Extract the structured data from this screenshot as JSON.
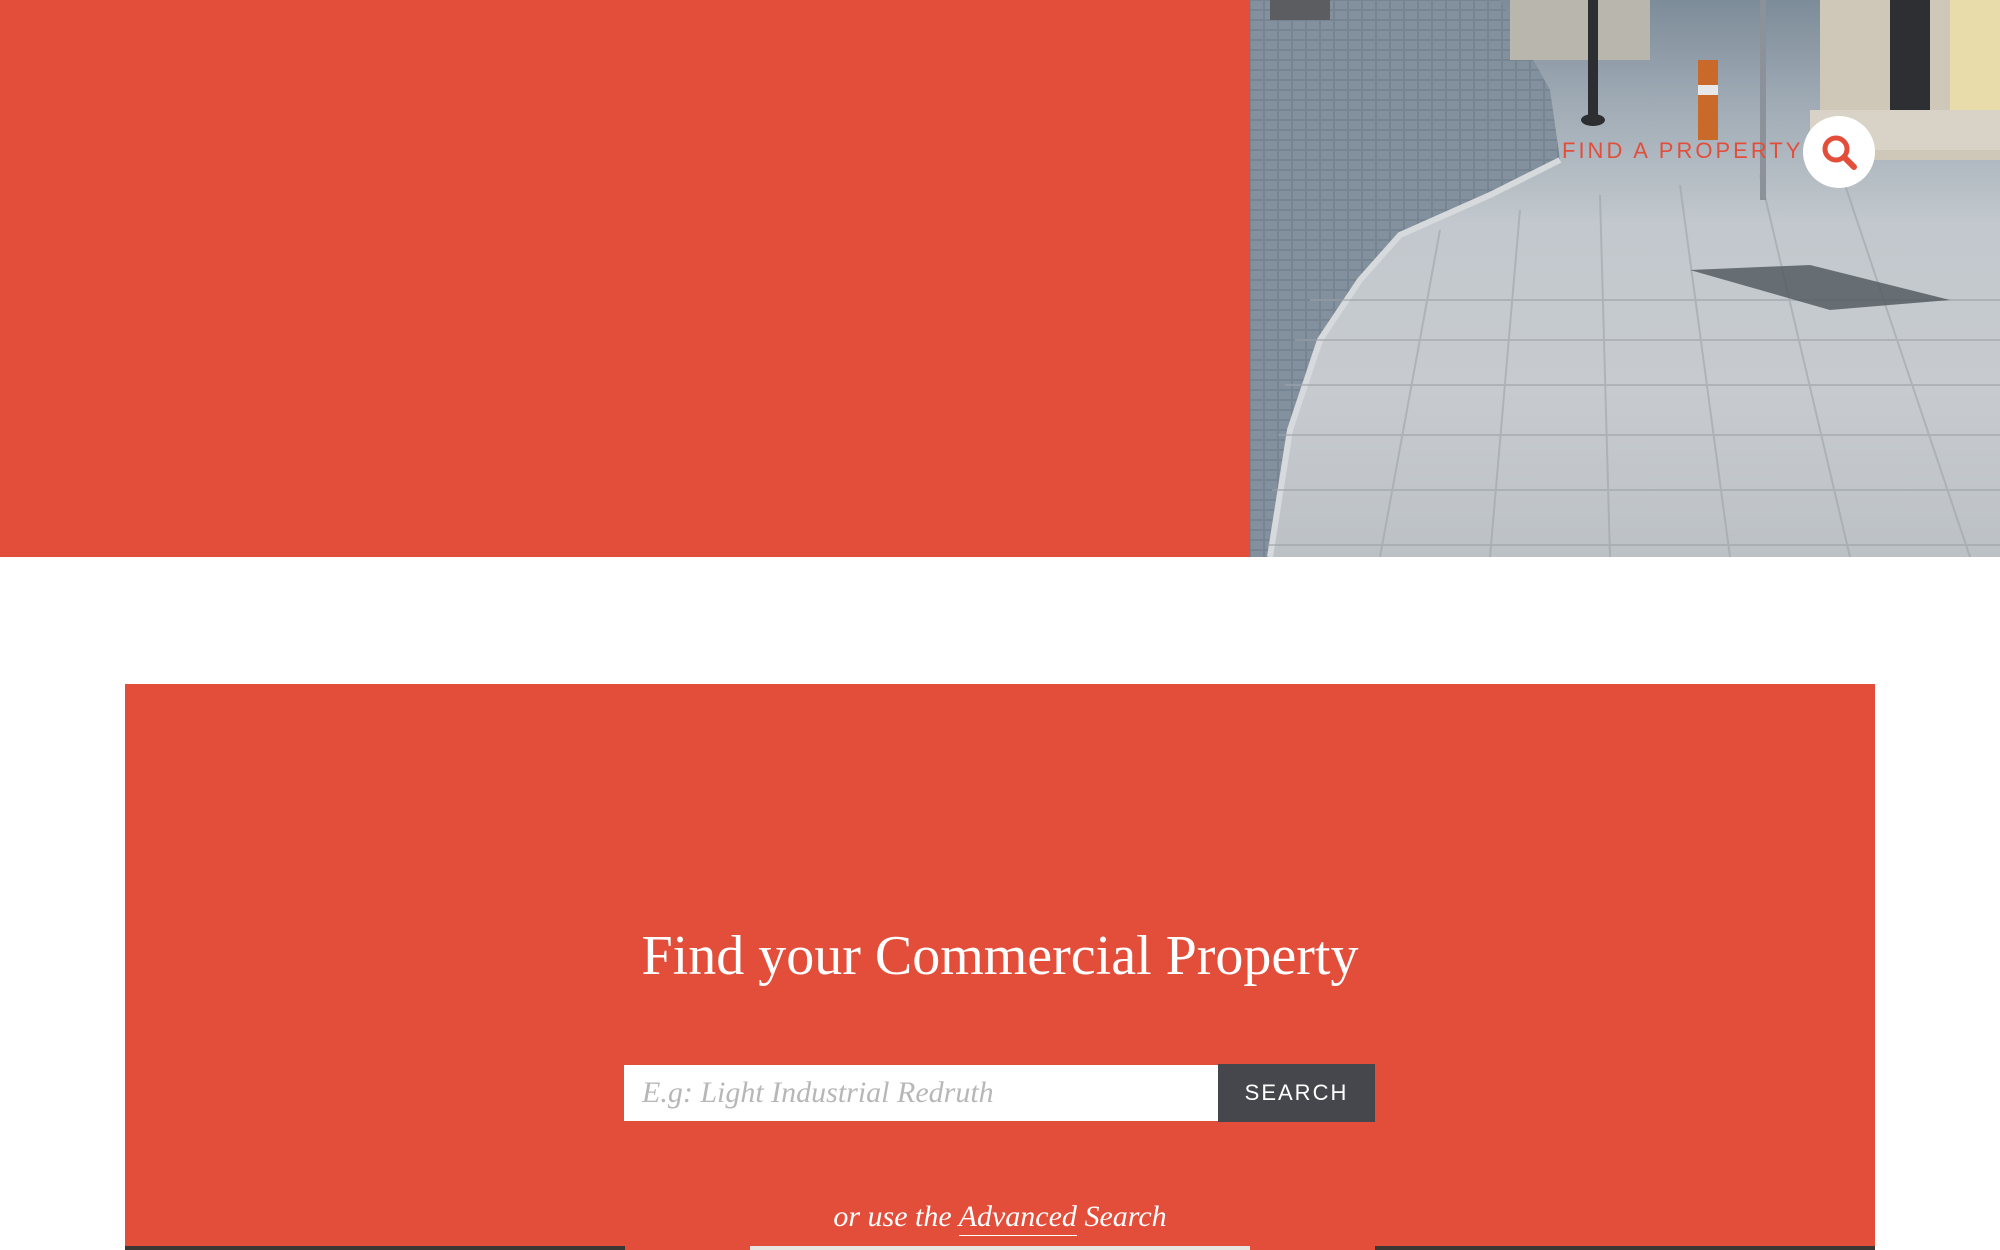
{
  "header": {
    "find_property_label": "FIND A PROPERTY",
    "search_icon": "search-icon"
  },
  "search_panel": {
    "title": "Find your Commercial Property",
    "input_placeholder": "E.g: Light Industrial Redruth",
    "input_value": "",
    "button_label": "SEARCH",
    "advanced_prefix": "or use the",
    "advanced_link_label": "Advanced",
    "advanced_suffix": "Search"
  },
  "colors": {
    "accent": "#e34e3b",
    "button_dark": "#45474c",
    "background": "#ffffff"
  }
}
